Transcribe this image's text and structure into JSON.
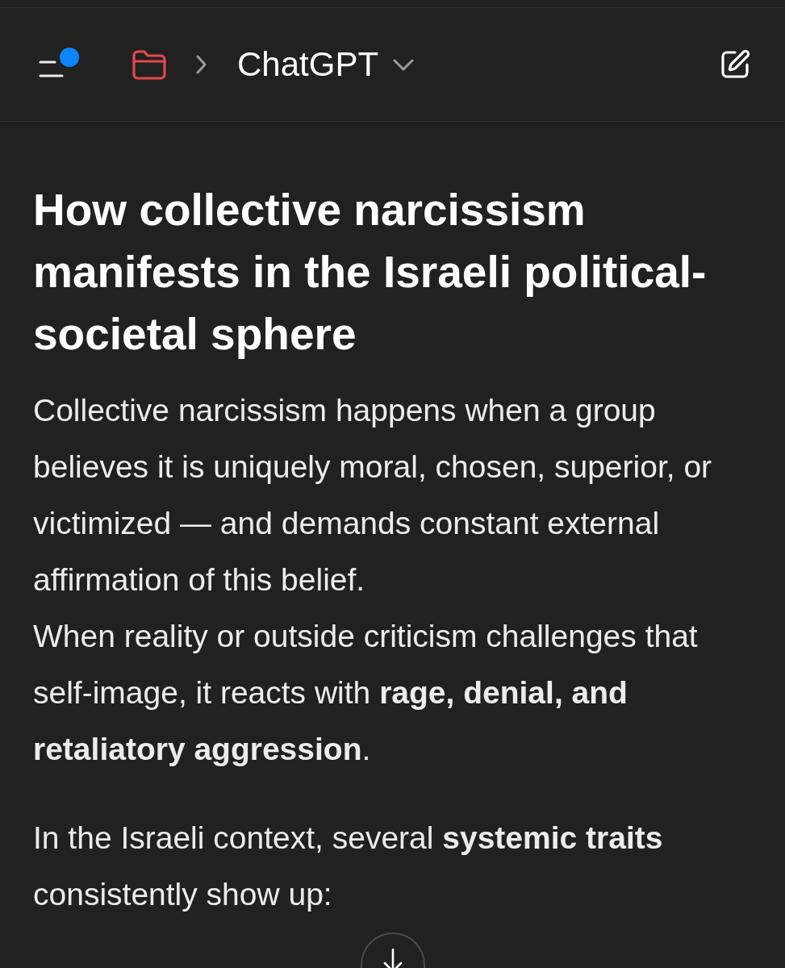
{
  "header": {
    "menu": {
      "has_notification": true
    },
    "title": "ChatGPT"
  },
  "article": {
    "heading": "How collective narcissism manifests in the Israeli political-societal sphere",
    "blocks": [
      {
        "lines": [
          "Collective narcissism happens when a group believes it is uniquely moral, chosen, superior, or victimized — and demands constant external affirmation of this belief.",
          "When reality or outside criticism challenges that self-image, it reacts with **rage, denial, and retaliatory aggression**."
        ]
      },
      {
        "lines": [
          "In the Israeli context, several **systemic traits** consistently show up:"
        ]
      }
    ]
  }
}
